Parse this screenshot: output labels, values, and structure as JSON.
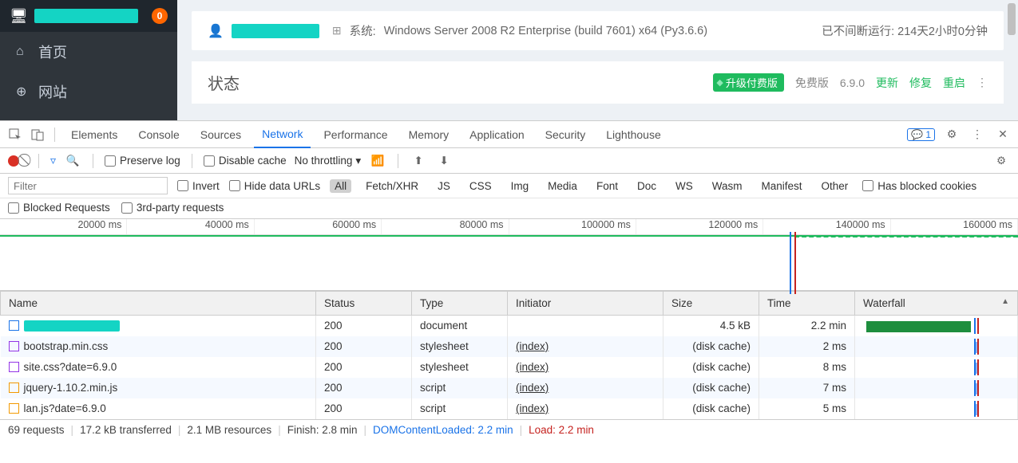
{
  "sidebar": {
    "badge": "0",
    "items": [
      {
        "label": "首页"
      },
      {
        "label": "网站"
      }
    ]
  },
  "header": {
    "system_label": "系统:",
    "system_value": "Windows Server 2008 R2 Enterprise (build 7601) x64 (Py3.6.6)",
    "uptime": "已不间断运行: 214天2小时0分钟"
  },
  "status": {
    "title": "状态",
    "upgrade": "升级付费版",
    "free": "免费版",
    "version": "6.9.0",
    "update": "更新",
    "repair": "修复",
    "restart": "重启"
  },
  "devtools": {
    "tabs": [
      "Elements",
      "Console",
      "Sources",
      "Network",
      "Performance",
      "Memory",
      "Application",
      "Security",
      "Lighthouse"
    ],
    "active_tab": "Network",
    "msg_count": "1"
  },
  "toolbar": {
    "preserve_log": "Preserve log",
    "disable_cache": "Disable cache",
    "throttling": "No throttling"
  },
  "filters": {
    "placeholder": "Filter",
    "invert": "Invert",
    "hide_urls": "Hide data URLs",
    "types": [
      "All",
      "Fetch/XHR",
      "JS",
      "CSS",
      "Img",
      "Media",
      "Font",
      "Doc",
      "WS",
      "Wasm",
      "Manifest",
      "Other"
    ],
    "blocked_cookies": "Has blocked cookies",
    "blocked_requests": "Blocked Requests",
    "third_party": "3rd-party requests"
  },
  "timeline": {
    "ticks": [
      "20000 ms",
      "40000 ms",
      "60000 ms",
      "80000 ms",
      "100000 ms",
      "120000 ms",
      "140000 ms",
      "160000 ms"
    ]
  },
  "table": {
    "headers": {
      "name": "Name",
      "status": "Status",
      "type": "Type",
      "initiator": "Initiator",
      "size": "Size",
      "time": "Time",
      "waterfall": "Waterfall"
    },
    "rows": [
      {
        "icon": "doc",
        "name": "",
        "redacted": true,
        "status": "200",
        "type": "document",
        "initiator": "",
        "size": "4.5 kB",
        "time": "2.2 min"
      },
      {
        "icon": "css",
        "name": "bootstrap.min.css",
        "status": "200",
        "type": "stylesheet",
        "initiator": "(index)",
        "size": "(disk cache)",
        "time": "2 ms"
      },
      {
        "icon": "css",
        "name": "site.css?date=6.9.0",
        "status": "200",
        "type": "stylesheet",
        "initiator": "(index)",
        "size": "(disk cache)",
        "time": "8 ms"
      },
      {
        "icon": "js",
        "name": "jquery-1.10.2.min.js",
        "status": "200",
        "type": "script",
        "initiator": "(index)",
        "size": "(disk cache)",
        "time": "7 ms"
      },
      {
        "icon": "js",
        "name": "lan.js?date=6.9.0",
        "status": "200",
        "type": "script",
        "initiator": "(index)",
        "size": "(disk cache)",
        "time": "5 ms"
      }
    ]
  },
  "footer": {
    "requests": "69 requests",
    "transferred": "17.2 kB transferred",
    "resources": "2.1 MB resources",
    "finish": "Finish: 2.8 min",
    "dom": "DOMContentLoaded: 2.2 min",
    "load": "Load: 2.2 min"
  }
}
